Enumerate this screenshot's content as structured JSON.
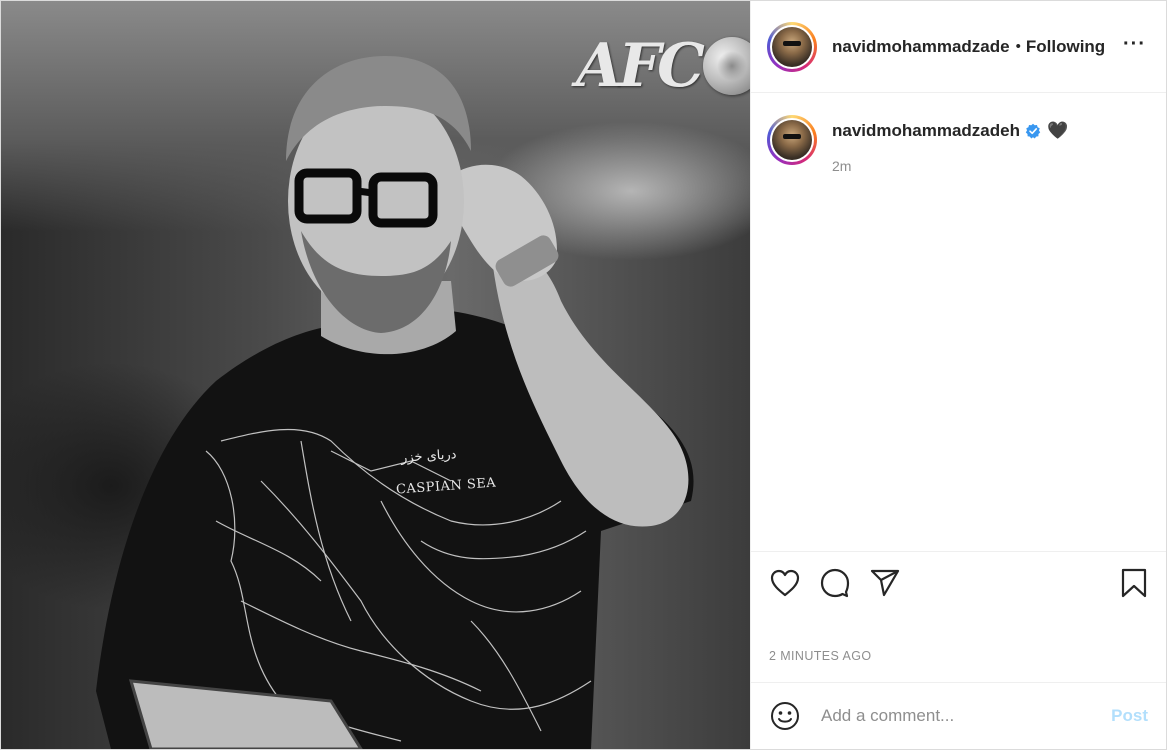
{
  "photo": {
    "logo_text": "AFC",
    "shirt_text_en": "CASPIAN SEA",
    "shirt_text_fa": "دریای خزر"
  },
  "header": {
    "username": "navidmohammadzade",
    "separator": "•",
    "follow_status": "Following",
    "more_label": "···"
  },
  "caption": {
    "username": "navidmohammadzadeh",
    "verified": true,
    "text": "🖤",
    "time": "2m"
  },
  "actions": {
    "icons": [
      "heart-icon",
      "comment-icon",
      "share-icon",
      "bookmark-icon"
    ]
  },
  "post_time": "2 MINUTES AGO",
  "comment": {
    "placeholder": "Add a comment...",
    "post_label": "Post"
  },
  "colors": {
    "verified_blue": "#3897f0",
    "post_button_disabled": "#b2dffc",
    "secondary_text": "#8e8e8e"
  }
}
